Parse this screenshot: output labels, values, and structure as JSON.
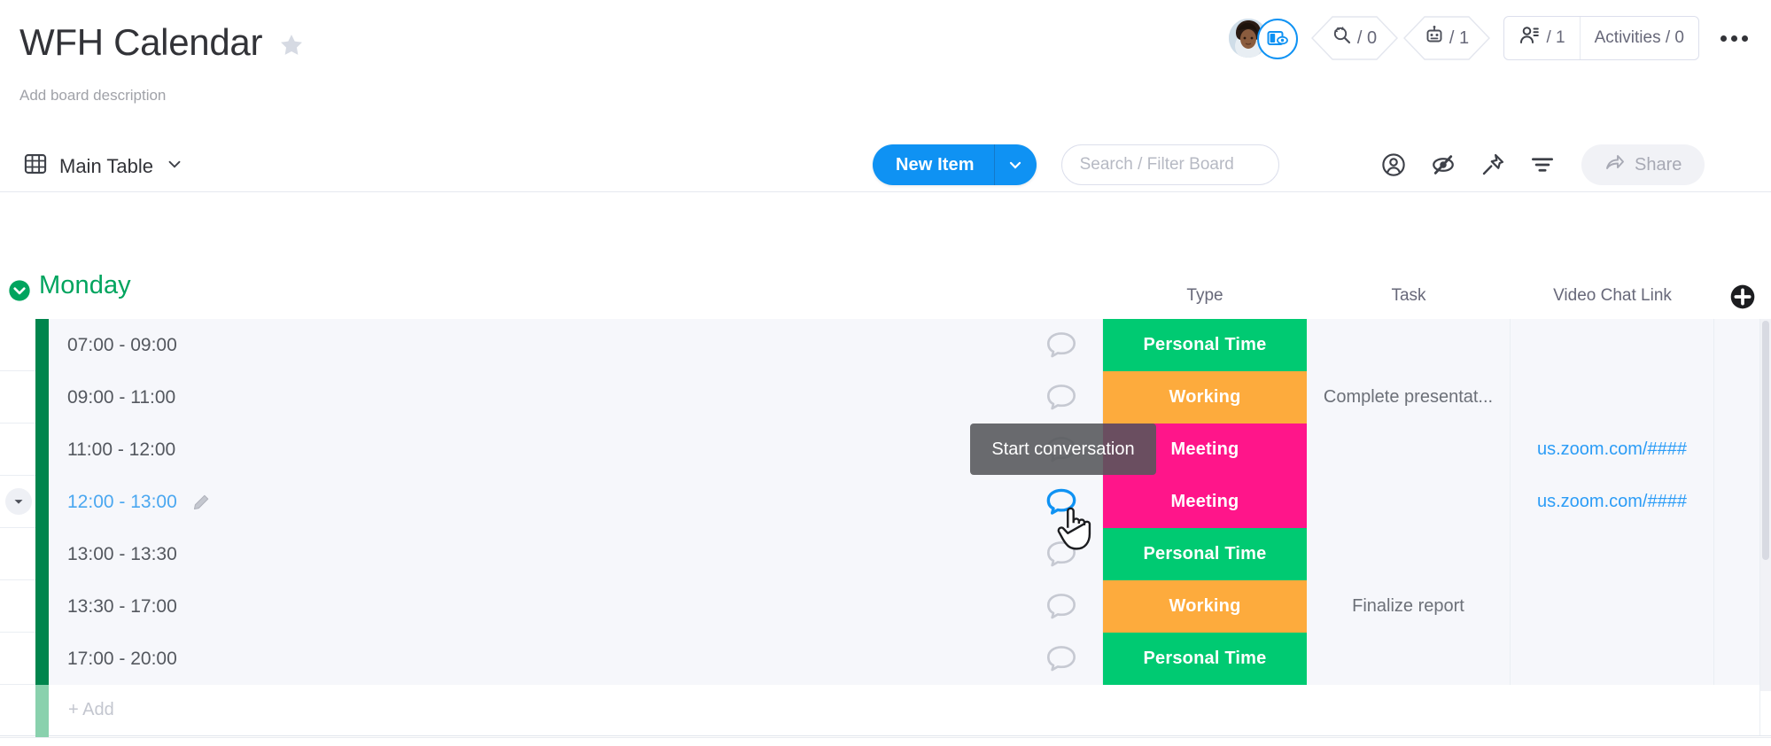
{
  "board": {
    "title": "WFH Calendar",
    "description": "Add board description",
    "star_icon": "star-icon"
  },
  "header": {
    "avatar_badge_icon": "board-view-icon",
    "chips": [
      {
        "icon": "automation-search-icon",
        "label": "/ 0"
      },
      {
        "icon": "robot-icon",
        "label": "/ 1"
      }
    ],
    "pills": [
      {
        "icon": "people-icon",
        "label": "/ 1"
      },
      {
        "icon": "",
        "label": "Activities / 0"
      }
    ],
    "more_icon": "more-options-icon"
  },
  "toolbar": {
    "view_icon": "table-view-icon",
    "view_label": "Main Table",
    "view_caret_icon": "chevron-down-icon",
    "new_item_label": "New Item",
    "new_item_caret_icon": "chevron-down-icon",
    "search_placeholder": "Search / Filter Board",
    "search_value": "",
    "icons": [
      {
        "name": "person-icon"
      },
      {
        "name": "hide-icon"
      },
      {
        "name": "pin-icon"
      },
      {
        "name": "filter-icon"
      }
    ],
    "share_label": "Share",
    "share_icon": "share-arrow-icon"
  },
  "group": {
    "name": "Monday",
    "color": "#00a45e",
    "bar_color": "#00854d",
    "collapse_icon": "collapse-group-icon"
  },
  "columns": [
    {
      "key": "type",
      "label": "Type"
    },
    {
      "key": "task",
      "label": "Task"
    },
    {
      "key": "link",
      "label": "Video Chat Link"
    }
  ],
  "add_column_icon": "add-column-icon",
  "rows": [
    {
      "name": "07:00 - 09:00",
      "status": "Personal Time",
      "status_color": "#00ca72",
      "task": "",
      "link": "",
      "selected": false,
      "bubble": "chat-bubble-icon",
      "bubble_active": false
    },
    {
      "name": "09:00 - 11:00",
      "status": "Working",
      "status_color": "#fdab3d",
      "task": "Complete presentat...",
      "link": "",
      "selected": false,
      "bubble": "chat-bubble-icon",
      "bubble_active": false
    },
    {
      "name": "11:00 - 12:00",
      "status": "Meeting",
      "status_color": "#ff158a",
      "task": "",
      "link": "us.zoom.com/####",
      "selected": false,
      "bubble": "chat-bubble-icon",
      "bubble_active": false
    },
    {
      "name": "12:00 - 13:00",
      "status": "Meeting",
      "status_color": "#ff158a",
      "task": "",
      "link": "us.zoom.com/####",
      "selected": true,
      "bubble": "chat-bubble-icon",
      "bubble_active": true
    },
    {
      "name": "13:00 - 13:30",
      "status": "Personal Time",
      "status_color": "#00ca72",
      "task": "",
      "link": "",
      "selected": false,
      "bubble": "chat-bubble-icon",
      "bubble_active": false
    },
    {
      "name": "13:30 - 17:00",
      "status": "Working",
      "status_color": "#fdab3d",
      "task": "Finalize report",
      "link": "",
      "selected": false,
      "bubble": "chat-bubble-icon",
      "bubble_active": false
    },
    {
      "name": "17:00 - 20:00",
      "status": "Personal Time",
      "status_color": "#00ca72",
      "task": "",
      "link": "",
      "selected": false,
      "bubble": "chat-bubble-icon",
      "bubble_active": false
    }
  ],
  "add_row_label": "+ Add",
  "tooltip": {
    "text": "Start conversation"
  },
  "colors": {
    "accent_blue": "#0f92f3",
    "green": "#00ca72",
    "orange": "#fdab3d",
    "pink": "#ff158a",
    "group_green": "#00a45e",
    "link_blue": "#2b9cf6"
  }
}
